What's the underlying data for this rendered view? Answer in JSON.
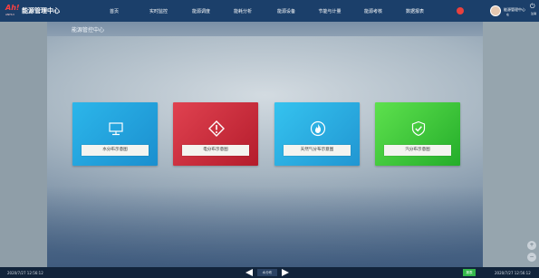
{
  "header": {
    "logo_text": "Ah!",
    "logo_subtext": "ANHUI",
    "system_title": "能源管理中心",
    "nav": [
      "首页",
      "实时监控",
      "能源调度",
      "能耗分析",
      "能源设备",
      "节能与计量",
      "能源考核",
      "数据报表"
    ],
    "alert_count": "",
    "user_name": "能源管理中心",
    "user_sub": "在",
    "power_label": "注销"
  },
  "main": {
    "title": "能源管控中心",
    "cards": [
      {
        "label": "水分布示意图",
        "icon": "monitor-icon",
        "color": "#1fa2dd"
      },
      {
        "label": "电分布示意图",
        "icon": "warning-diamond-icon",
        "color": "#d8303f"
      },
      {
        "label": "天然气分布示意图",
        "icon": "flame-icon",
        "color": "#29aee3"
      },
      {
        "label": "汽分布示意图",
        "icon": "shield-check-icon",
        "color": "#3cc73a"
      }
    ]
  },
  "footer": {
    "timestamp_left": "2020/7/27 12:56:12",
    "page_label": "水分布",
    "green_button": "报表",
    "timestamp_right": "2020/7/27 12:56:12"
  },
  "side_buttons": [
    "+",
    "−"
  ]
}
